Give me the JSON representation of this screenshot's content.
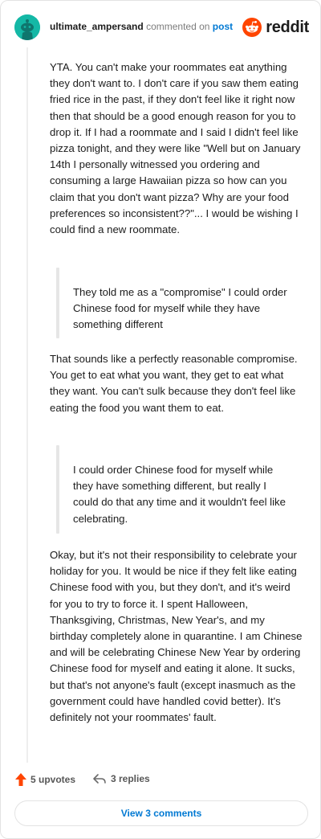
{
  "header": {
    "username": "ultimate_ampersand",
    "action": "commented on",
    "post_link": "post",
    "brand": "reddit",
    "brand_color": "#ff4500",
    "avatar_color": "#14b8a6"
  },
  "comment": {
    "paragraph_1": "YTA. You can't make your roommates eat anything they don't want to. I don't care if you saw them eating fried rice in the past, if they don't feel like it right now then that should be a good enough reason for you to drop it. If I had a roommate and I said I didn't feel like pizza tonight, and they were like \"Well but on January 14th I personally witnessed you ordering and consuming a large Hawaiian pizza so how can you claim that you don't want pizza? Why are your food preferences so inconsistent??\"... I would be wishing I could find a new roommate.",
    "quote_1": "They told me as a \"compromise\" I could order Chinese food for myself while they have something different",
    "paragraph_2": "That sounds like a perfectly reasonable compromise. You get to eat what you want, they get to eat what they want. You can't sulk because they don't feel like eating the food you want them to eat.",
    "quote_2": "I could order Chinese food for myself while they have something different, but really I could do that any time and it wouldn't feel like celebrating.",
    "paragraph_3": "Okay, but it's not their responsibility to celebrate your holiday for you. It would be nice if they felt like eating Chinese food with you, but they don't, and it's weird for you to try to force it. I spent Halloween, Thanksgiving, Christmas, New Year's, and my birthday completely alone in quarantine. I am Chinese and will be celebrating Chinese New Year by ordering Chinese food for myself and eating it alone. It sucks, but that's not anyone's fault (except inasmuch as the government could have handled covid better). It's definitely not your roommates' fault."
  },
  "footer": {
    "upvotes": "5 upvotes",
    "upvote_icon": "upvote-arrow-icon",
    "upvote_color": "#ff4500",
    "replies": "3 replies",
    "reply_icon": "reply-arrow-icon",
    "view_comments": "View 3 comments",
    "link_color": "#0079d3"
  }
}
